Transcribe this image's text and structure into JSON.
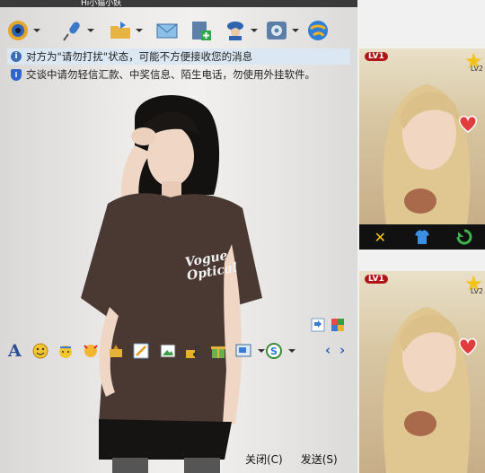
{
  "window": {
    "title": "Hi小猫小妖"
  },
  "notices": {
    "dnd_message": "对方为\"请勿打扰\"状态，可能不方便接收您的消息",
    "safety_message": "交谈中请勿轻信汇款、中奖信息、陌生电话，勿使用外挂软件。"
  },
  "shirt_text": {
    "brand_line1": "Vogue",
    "brand_line2": "Optical"
  },
  "video_panes": [
    {
      "level_badge": "LV1",
      "star_label": "LV2"
    },
    {
      "level_badge": "LV1",
      "star_label": "LV2"
    }
  ],
  "buttons": {
    "close_label": "关闭(C)",
    "send_label": "发送(S)"
  },
  "colors": {
    "notice_bg": "#dbe8f4",
    "control_bar": "#111111",
    "badge_red": "#b01515",
    "star_gold": "#f3c21b"
  }
}
